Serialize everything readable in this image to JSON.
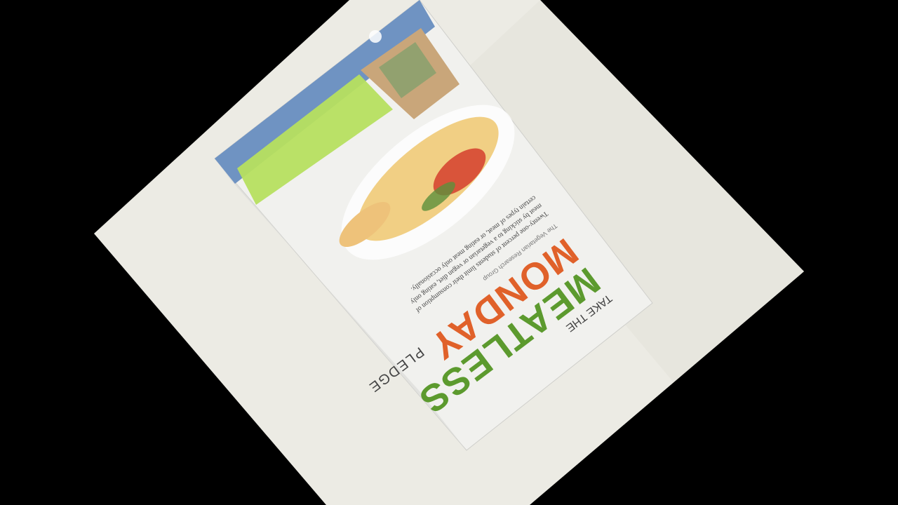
{
  "photo": {
    "description_tag": "magazine-on-board",
    "colors": {
      "background": "#000000",
      "board": "#ecebe4",
      "board_shadow": "#d9d8d0",
      "magazine": "#f2f2f0",
      "header_blue": "#6b8fbf",
      "highlight_green": "#b5de5c",
      "meatless_green": "#5c9a2e",
      "monday_orange": "#e0612a",
      "text_dark": "#3a3a3a"
    }
  },
  "magazine": {
    "headline_small": "TAKE THE",
    "headline_main_1": "MEATLESS",
    "headline_main_2": "MONDAY",
    "headline_sub": "PLEDGE",
    "body_line_1": "Twenty-one percent of students limit their consumption of",
    "body_line_2": "certain types of meat, or eating meat only occasionally.",
    "body_line_3": "meat by sticking to a vegetarian or vegan diet, eating only",
    "credit": "The Vegetarian Research Group"
  }
}
